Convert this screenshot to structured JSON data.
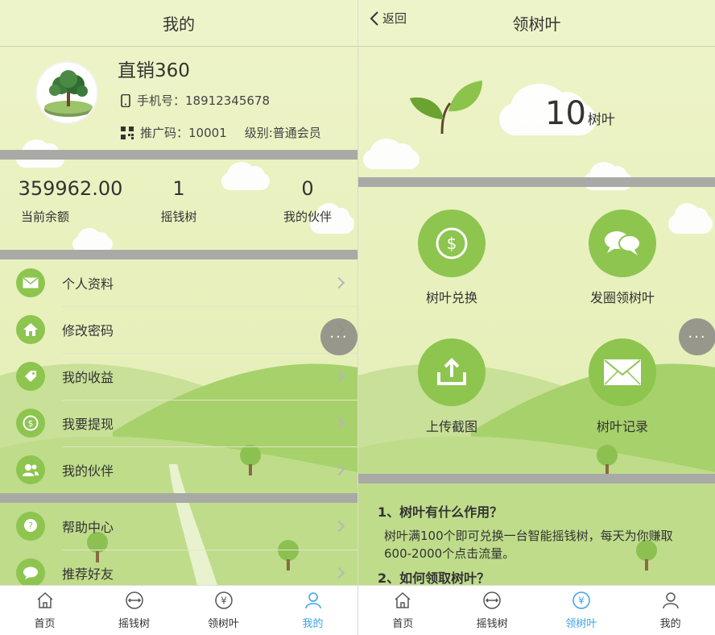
{
  "left": {
    "title": "我的",
    "profile": {
      "name": "直销360",
      "phone_label": "手机号：",
      "phone": "18912345678",
      "promo_label": "推广码：",
      "promo": "10001",
      "level": "级别:普通会员"
    },
    "stats": [
      {
        "value": "359962.00",
        "label": "当前余额"
      },
      {
        "value": "1",
        "label": "摇钱树"
      },
      {
        "value": "0",
        "label": "我的伙伴"
      }
    ],
    "menu": [
      {
        "label": "个人资料",
        "icon": "envelope-icon"
      },
      {
        "label": "修改密码",
        "icon": "home-icon"
      },
      {
        "label": "我的收益",
        "icon": "tag-icon"
      },
      {
        "label": "我要提现",
        "icon": "coin-icon"
      },
      {
        "label": "我的伙伴",
        "icon": "people-icon"
      },
      {
        "label": "帮助中心",
        "icon": "help-icon"
      },
      {
        "label": "推荐好友",
        "icon": "chat-icon"
      }
    ]
  },
  "right": {
    "back": "返回",
    "title": "领树叶",
    "leaf_count": "10",
    "leaf_unit": "树叶",
    "features": [
      {
        "label": "树叶兑换",
        "icon": "dollar-icon"
      },
      {
        "label": "发圈领树叶",
        "icon": "chat-bubbles-icon"
      },
      {
        "label": "上传截图",
        "icon": "upload-icon"
      },
      {
        "label": "树叶记录",
        "icon": "mail-icon"
      }
    ],
    "faq": {
      "q1": "1、树叶有什么作用？",
      "a1": "树叶满100个即可兑换一台智能摇钱树，每天为你赚取600-2000个点击流量。",
      "q2": "2、如何领取树叶？"
    }
  },
  "float_button": "···",
  "tabs": {
    "left": [
      {
        "label": "首页"
      },
      {
        "label": "摇钱树"
      },
      {
        "label": "领树叶"
      },
      {
        "label": "我的"
      }
    ],
    "right": [
      {
        "label": "首页"
      },
      {
        "label": "摇钱树"
      },
      {
        "label": "领树叶"
      },
      {
        "label": "我的"
      }
    ]
  },
  "colors": {
    "accent_green": "#8dc54f",
    "active_tab": "#3aa3e8"
  }
}
